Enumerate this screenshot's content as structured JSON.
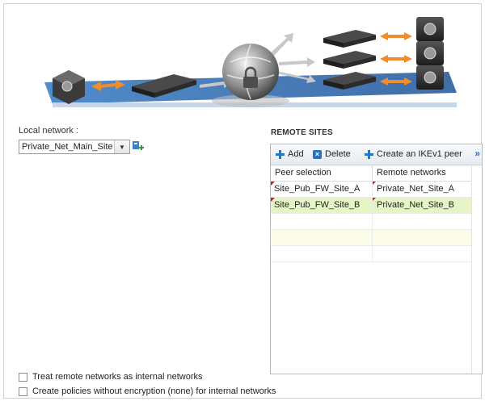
{
  "local_network": {
    "label": "Local network :",
    "selected": "Private_Net_Main_Site"
  },
  "remote_sites": {
    "title": "REMOTE SITES",
    "toolbar": {
      "add_label": "Add",
      "delete_label": "Delete",
      "create_label": "Create an IKEv1 peer",
      "more_label": "»"
    },
    "columns": [
      "Peer selection",
      "Remote networks"
    ],
    "rows": [
      {
        "peer": "Site_Pub_FW_Site_A",
        "network": "Private_Net_Site_A"
      },
      {
        "peer": "Site_Pub_FW_Site_B",
        "network": "Private_Net_Site_B"
      }
    ]
  },
  "options": {
    "treat_internal": "Treat remote networks as internal networks",
    "create_policies": "Create policies without encryption (none) for internal networks"
  },
  "colors": {
    "accent": "#1f79c9",
    "selected_row": "#e6f4c6",
    "arrow": "#f08c2a",
    "floor": "#2f6fb5"
  }
}
